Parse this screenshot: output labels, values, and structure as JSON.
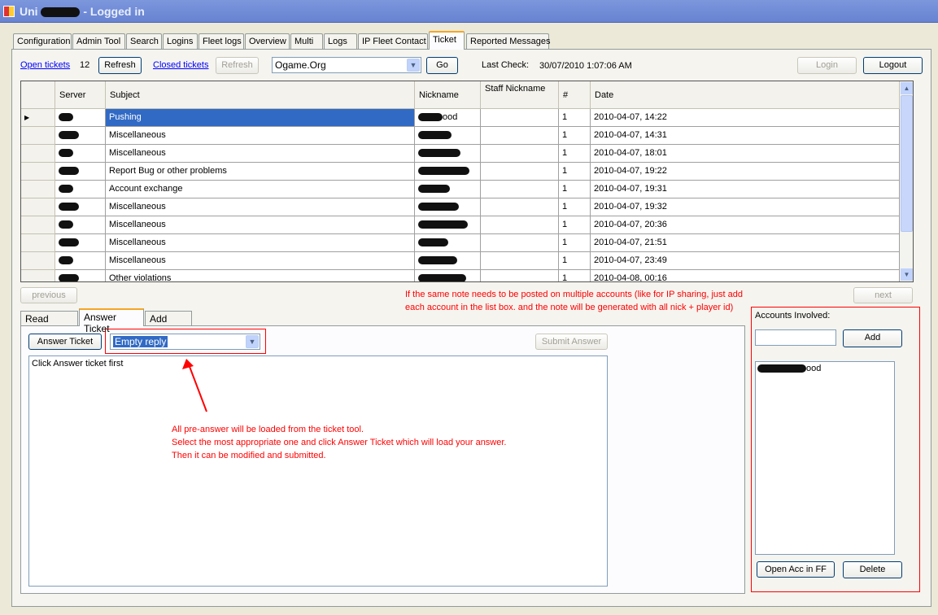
{
  "window": {
    "title_prefix": "Uni",
    "title_suffix": "- Logged in"
  },
  "tabs": [
    "Configuration",
    "Admin Tool",
    "Search",
    "Logins",
    "Fleet logs",
    "Overview",
    "Multi",
    "Logs",
    "IP Fleet Contact",
    "Ticket",
    "Reported Messages"
  ],
  "active_tab": "Ticket",
  "toolbar": {
    "open_tickets": "Open tickets",
    "open_count": "12",
    "refresh": "Refresh",
    "closed_tickets": "Closed tickets",
    "refresh_closed": "Refresh",
    "server_select": "Ogame.Org",
    "go": "Go",
    "last_check_label": "Last Check:",
    "last_check_value": "30/07/2010 1:07:06 AM",
    "login": "Login",
    "logout": "Logout"
  },
  "grid": {
    "columns": [
      "Server",
      "Subject",
      "Nickname",
      "Staff Nickname",
      "#",
      "Date"
    ],
    "rows": [
      {
        "subject": "Pushing",
        "count": "1",
        "date": "2010-04-07, 14:22",
        "nick_visible": "ood"
      },
      {
        "subject": "Miscellaneous",
        "count": "1",
        "date": "2010-04-07, 14:31"
      },
      {
        "subject": "Miscellaneous",
        "count": "1",
        "date": "2010-04-07, 18:01"
      },
      {
        "subject": "Report Bug or other problems",
        "count": "1",
        "date": "2010-04-07, 19:22"
      },
      {
        "subject": "Account exchange",
        "count": "1",
        "date": "2010-04-07, 19:31"
      },
      {
        "subject": "Miscellaneous",
        "count": "1",
        "date": "2010-04-07, 19:32"
      },
      {
        "subject": "Miscellaneous",
        "count": "1",
        "date": "2010-04-07, 20:36"
      },
      {
        "subject": "Miscellaneous",
        "count": "1",
        "date": "2010-04-07, 21:51"
      },
      {
        "subject": "Miscellaneous",
        "count": "1",
        "date": "2010-04-07, 23:49"
      },
      {
        "subject": "Other violations",
        "count": "1",
        "date": "2010-04-08, 00:16"
      }
    ]
  },
  "nav": {
    "previous": "previous",
    "next": "next"
  },
  "notes": {
    "multi_accounts": "If the same note needs to be posted on multiple accounts (like for IP sharing, just add each account in the list box. and the note will be generated with all nick + player id)",
    "pre_answer_1": "All pre-answer will be loaded from the ticket tool.",
    "pre_answer_2": "Select the most appropriate one and click Answer Ticket which will load your answer.",
    "pre_answer_3": "Then it can be modified and submitted."
  },
  "bottom_tabs": [
    "Read Ticket",
    "Answer Ticket",
    "Add Notes"
  ],
  "answer": {
    "answer_button": "Answer Ticket",
    "reply_select": "Empty reply",
    "submit": "Submit Answer",
    "text": "Click Answer ticket first"
  },
  "accounts": {
    "label": "Accounts Involved:",
    "input_value": "",
    "add": "Add",
    "items": [
      {
        "visible": "ood"
      }
    ],
    "open_ff": "Open Acc in FF",
    "delete": "Delete"
  },
  "colors": {
    "annotation": "#ff0000",
    "selection": "#316ac5",
    "titlebar": "#7d97dc"
  }
}
